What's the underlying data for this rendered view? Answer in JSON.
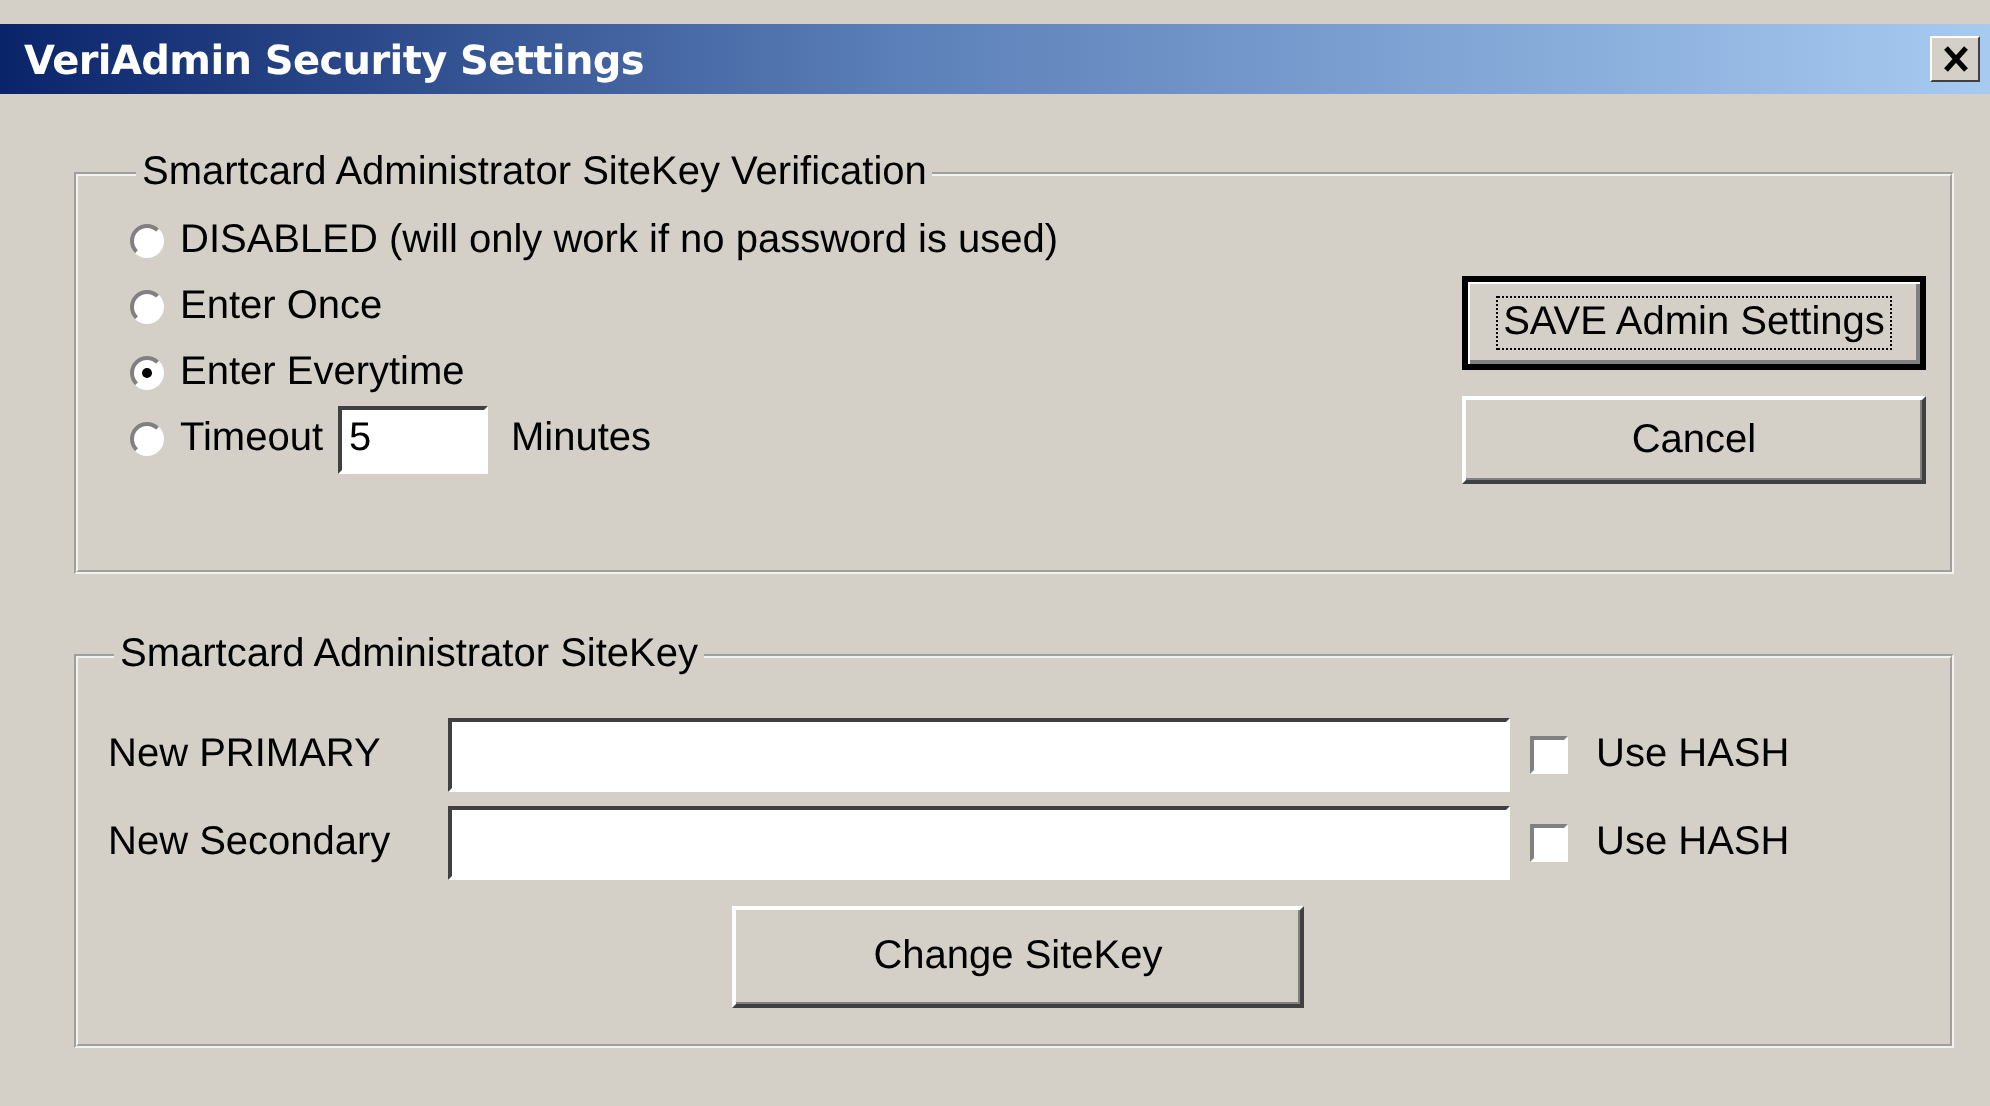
{
  "window": {
    "title": "VeriAdmin Security Settings"
  },
  "verification": {
    "legend": "Smartcard Administrator SiteKey Verification",
    "options": [
      {
        "kind": "plain",
        "label": "DISABLED (will only work if no password is used)",
        "selected": false
      },
      {
        "kind": "plain",
        "label": "Enter Once",
        "selected": false
      },
      {
        "kind": "plain",
        "label": "Enter Everytime",
        "selected": true
      },
      {
        "kind": "timeout",
        "label": "Timeout",
        "selected": false,
        "value": "5",
        "suffix": "Minutes"
      }
    ],
    "buttons": [
      {
        "label": "SAVE Admin Settings",
        "focused": true
      },
      {
        "label": "Cancel",
        "focused": false
      }
    ]
  },
  "sitekey": {
    "legend": "Smartcard Administrator SiteKey",
    "fields": [
      {
        "label": "New PRIMARY",
        "hash_label": "Use HASH",
        "hash_checked": false
      },
      {
        "label": "New Secondary",
        "hash_label": "Use HASH",
        "hash_checked": false
      }
    ],
    "button": {
      "label": "Change SiteKey",
      "focused": false
    }
  }
}
